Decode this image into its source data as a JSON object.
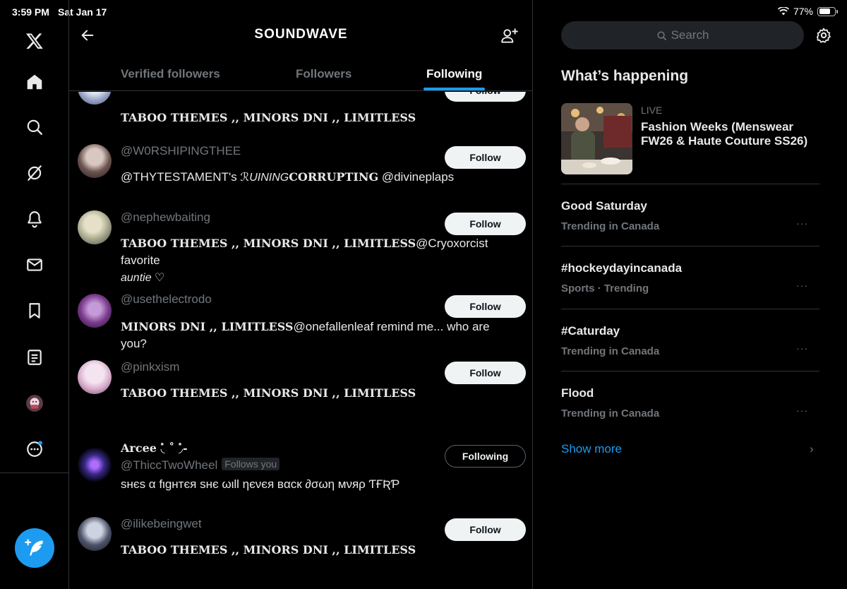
{
  "status_bar": {
    "time": "3:59 PM",
    "date": "Sat Jan 17",
    "battery_text": "77%",
    "battery_level": 0.77
  },
  "left_nav": {
    "icons": [
      "x-logo-icon",
      "home-icon",
      "search-icon",
      "grok-icon",
      "notifications-icon",
      "messages-icon",
      "bookmarks-icon",
      "lists-icon",
      "profile-avatar-icon",
      "more-icon"
    ],
    "compose_icon": "compose-post-icon"
  },
  "header": {
    "title": "SOUNDWAVE"
  },
  "tabs": [
    {
      "label": "Verified followers"
    },
    {
      "label": "Followers"
    },
    {
      "label": "Following"
    }
  ],
  "users": [
    {
      "handle": "",
      "bio_bold": "TABOO THEMES ,, MINORS DNI ,, LIMITLESS",
      "bio_rest": "",
      "button": "Follow"
    },
    {
      "handle": "@W0RSHIPINGTHEE",
      "bio_pre": "@THYTESTAMENT's ",
      "bio_bold": "ℛUINING",
      "bio_bold2": "CORRUPTING",
      "bio_rest": " @divineplaps",
      "button": "Follow"
    },
    {
      "handle": "@nephewbaiting",
      "bio_bold": "TABOO THEMES ,, MINORS DNI ,, LIMITLESS",
      "bio_rest": "@Cryoxorcist favorite",
      "bio_line2": "auntie ♡",
      "button": "Follow"
    },
    {
      "handle": "@usethelectrodo",
      "bio_bold": "MINORS DNI ,, LIMITLESS",
      "bio_rest": "@onefallenleaf remind me... who are you?",
      "button": "Follow"
    },
    {
      "handle": "@pinkxism",
      "bio_bold": "TABOO THEMES ,, MINORS DNI ,, LIMITLESS",
      "bio_rest": "",
      "button": "Follow"
    },
    {
      "name": "Arcee ◟̽ ˚ ◞̽-",
      "handle": "@ThiccTwoWheel",
      "follows_you": "Follows you",
      "bio_rest": "sнєѕ α fιgнтєя sнє ωιll ηєνєя вαcк ∂σωη мνяρ ƬҒƦƤ",
      "button": "Following"
    },
    {
      "handle": "@ilikebeingwet",
      "bio_bold": "TABOO THEMES ,, MINORS DNI ,, LIMITLESS",
      "bio_rest": "",
      "button": "Follow"
    }
  ],
  "right": {
    "search_placeholder": "Search",
    "section_title": "What’s happening",
    "live": {
      "label": "LIVE",
      "title": "Fashion Weeks (Menswear FW26 & Haute Couture SS26)"
    },
    "trends": [
      {
        "title": "Good Saturday",
        "sub": "Trending in Canada",
        "more": "···"
      },
      {
        "title": "#hockeydayincanada",
        "sub": "Sports · Trending",
        "more": "···"
      },
      {
        "title": "#Caturday",
        "sub": "Trending in Canada",
        "more": "···"
      },
      {
        "title": "Flood",
        "sub": "Trending in Canada",
        "more": "···"
      }
    ],
    "show_more": "Show more",
    "chevron": "›"
  },
  "colors": {
    "accent": "#1d9bf0",
    "background": "#000000",
    "secondary_text": "#71767b",
    "divider": "#2f3336"
  }
}
